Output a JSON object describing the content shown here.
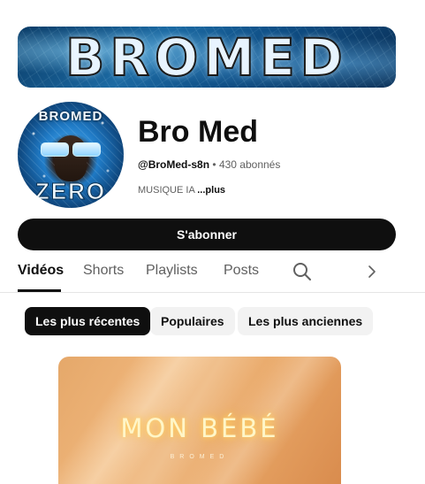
{
  "banner": {
    "text": "BROMED"
  },
  "avatar": {
    "top_text": "BROMED",
    "bottom_text": "ZERO"
  },
  "channel": {
    "name": "Bro Med",
    "handle": "@BroMed-s8n",
    "separator": "•",
    "subscribers": "430 abonnés",
    "description": "MUSIQUE IA",
    "more_label": "...plus"
  },
  "subscribe_label": "S'abonner",
  "tabs": [
    {
      "label": "Vidéos",
      "active": true
    },
    {
      "label": "Shorts",
      "active": false
    },
    {
      "label": "Playlists",
      "active": false
    },
    {
      "label": "Posts",
      "active": false
    }
  ],
  "tab_icons": {
    "search": "search-icon",
    "next": "chevron-right-icon"
  },
  "chips": [
    {
      "label": "Les plus récentes",
      "selected": true
    },
    {
      "label": "Populaires",
      "selected": false
    },
    {
      "label": "Les plus anciennes",
      "selected": false
    }
  ],
  "video": {
    "thumbnail_title": "MON BÉBÉ",
    "thumbnail_sub": "BROMED"
  },
  "colors": {
    "text_primary": "#0f0f0f",
    "text_secondary": "#606060",
    "chip_background": "#f2f2f2",
    "selected_chip": "#0f0f0f",
    "subscribe_button": "#0f0f0f"
  }
}
